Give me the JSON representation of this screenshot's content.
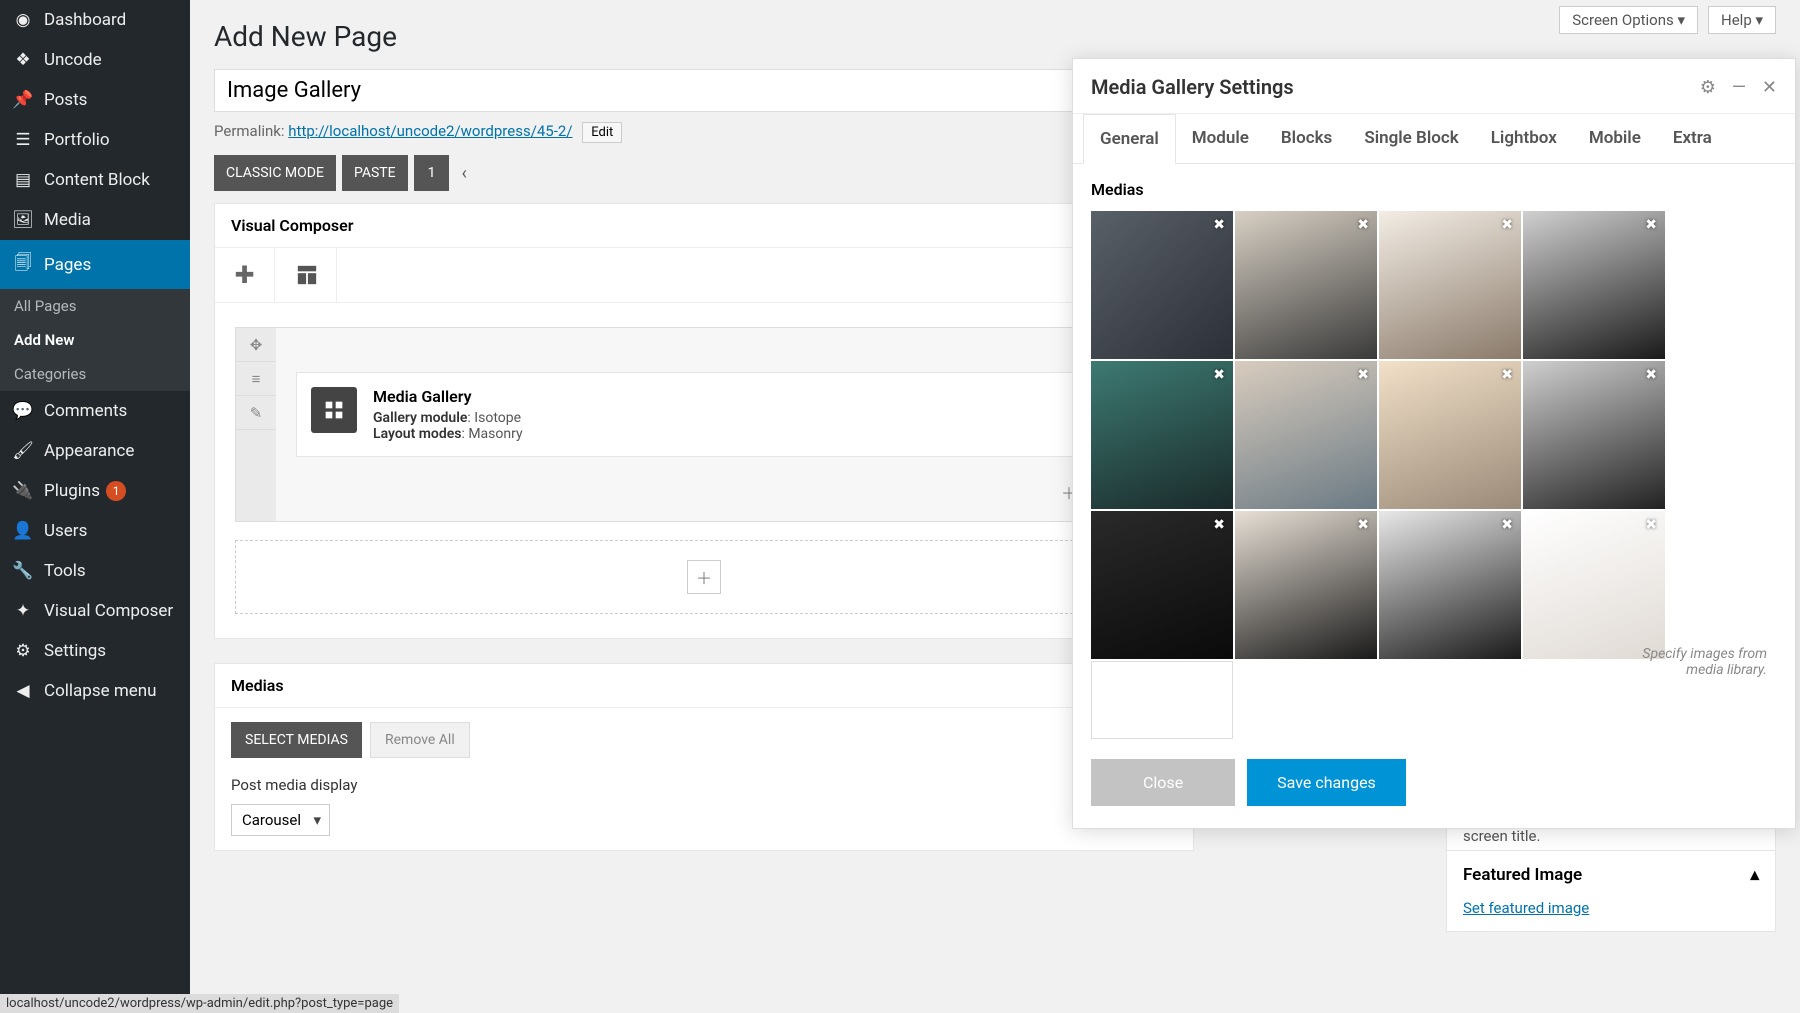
{
  "topbar": {
    "screen_options": "Screen Options",
    "help": "Help"
  },
  "sidebar": {
    "items": [
      {
        "label": "Dashboard",
        "icon": "◉"
      },
      {
        "label": "Uncode",
        "icon": "❖"
      },
      {
        "label": "Posts",
        "icon": "📌"
      },
      {
        "label": "Portfolio",
        "icon": "☰"
      },
      {
        "label": "Content Block",
        "icon": "▤"
      },
      {
        "label": "Media",
        "icon": "🖼"
      },
      {
        "label": "Pages",
        "icon": "🗐"
      },
      {
        "label": "Comments",
        "icon": "💬"
      },
      {
        "label": "Appearance",
        "icon": "🖌"
      },
      {
        "label": "Plugins",
        "icon": "🔌",
        "badge": "1"
      },
      {
        "label": "Users",
        "icon": "👤"
      },
      {
        "label": "Tools",
        "icon": "🔧"
      },
      {
        "label": "Visual Composer",
        "icon": "✦"
      },
      {
        "label": "Settings",
        "icon": "⚙"
      },
      {
        "label": "Collapse menu",
        "icon": "◀"
      }
    ],
    "sub": [
      {
        "label": "All Pages"
      },
      {
        "label": "Add New"
      },
      {
        "label": "Categories"
      }
    ]
  },
  "page": {
    "heading": "Add New Page",
    "title_value": "Image Gallery",
    "permalink_label": "Permalink:",
    "permalink_url": "http://localhost/uncode2/wordpress/45-2/",
    "edit": "Edit"
  },
  "toolbar": {
    "classic": "CLASSIC MODE",
    "paste": "PASTE",
    "num": "1"
  },
  "vc": {
    "title": "Visual Composer",
    "element": {
      "title": "Media Gallery",
      "module_label": "Gallery module",
      "module_value": "Isotope",
      "layout_label": "Layout modes",
      "layout_value": "Masonry"
    }
  },
  "medias": {
    "title": "Medias",
    "select": "SELECT MEDIAS",
    "remove": "Remove All",
    "display_label": "Post media display",
    "display_value": "Carousel"
  },
  "settings": {
    "title": "Media Gallery Settings",
    "tabs": [
      "General",
      "Module",
      "Blocks",
      "Single Block",
      "Lightbox",
      "Mobile",
      "Extra"
    ],
    "section_label": "Medias",
    "helper": "Specify images from media library.",
    "close": "Close",
    "save": "Save changes"
  },
  "featured": {
    "title": "Featured Image",
    "link": "Set featured image"
  },
  "help_box": "Need help? Use the Help tab above the screen title.",
  "status_url": "localhost/uncode2/wordpress/wp-admin/edit.php?post_type=page"
}
